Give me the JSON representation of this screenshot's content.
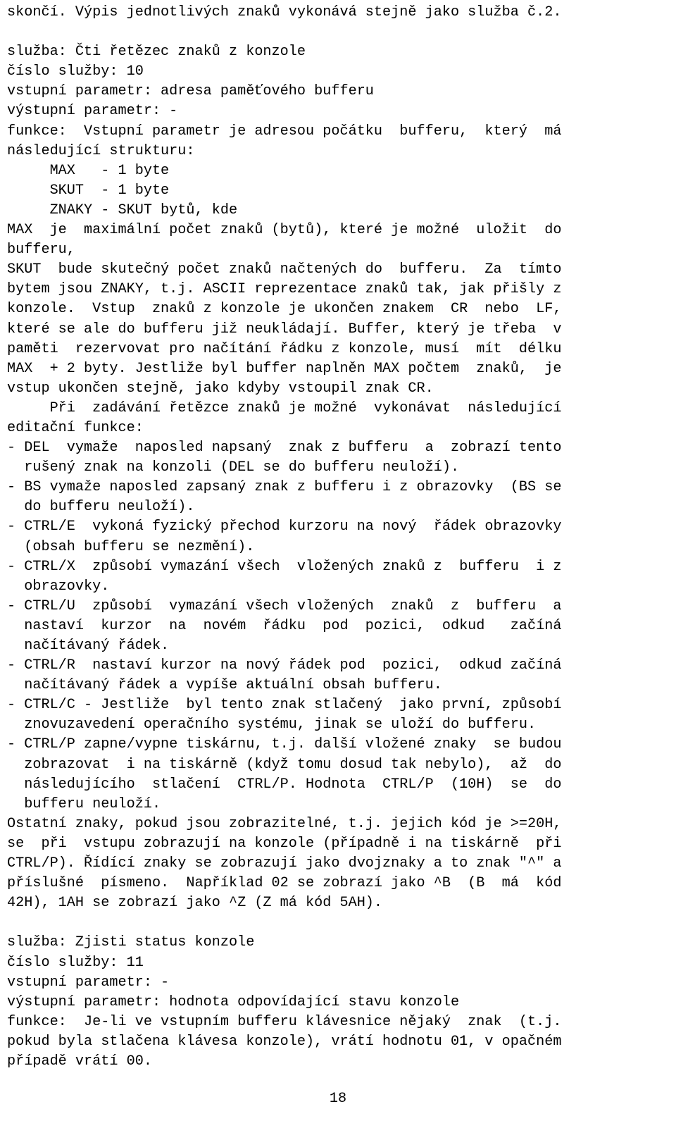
{
  "document": {
    "language": "cs",
    "page_number": "18",
    "body_lines": [
      "skončí. Výpis jednotlivých znaků vykonává stejně jako služba č.2.",
      "",
      "služba: Čti řetězec znaků z konzole",
      "číslo služby: 10",
      "vstupní parametr: adresa paměťového bufferu",
      "výstupní parametr: -",
      "funkce:  Vstupní parametr je adresou počátku  bufferu,  který  má",
      "následující strukturu:",
      "     MAX   - 1 byte",
      "     SKUT  - 1 byte",
      "     ZNAKY - SKUT bytů, kde",
      "MAX  je  maximální počet znaků (bytů), které je možné  uložit  do",
      "bufferu,",
      "SKUT  bude skutečný počet znaků načtených do  bufferu.  Za  tímto",
      "bytem jsou ZNAKY, t.j. ASCII reprezentace znaků tak, jak přišly z",
      "konzole.  Vstup  znaků z konzole je ukončen znakem  CR  nebo  LF,",
      "které se ale do bufferu již neukládají. Buffer, který je třeba  v",
      "paměti  rezervovat pro načítání řádku z konzole, musí  mít  délku",
      "MAX  + 2 byty. Jestliže byl buffer naplněn MAX počtem  znaků,  je",
      "vstup ukončen stejně, jako kdyby vstoupil znak CR.",
      "     Při  zadávání řetězce znaků je možné  vykonávat  následující",
      "editační funkce:",
      "- DEL  vymaže  naposled napsaný  znak z bufferu  a  zobrazí tento",
      "  rušený znak na konzoli (DEL se do bufferu neuloží).",
      "- BS vymaže naposled zapsaný znak z bufferu i z obrazovky  (BS se",
      "  do bufferu neuloží).",
      "- CTRL/E  vykoná fyzický přechod kurzoru na nový  řádek obrazovky",
      "  (obsah bufferu se nezmění).",
      "- CTRL/X  způsobí vymazání všech  vložených znaků z  bufferu  i z",
      "  obrazovky.",
      "- CTRL/U  způsobí  vymazání všech vložených  znaků  z  bufferu  a",
      "  nastaví  kurzor  na  novém  řádku  pod  pozici,  odkud   začíná",
      "  načítávaný řádek.",
      "- CTRL/R  nastaví kurzor na nový řádek pod  pozici,  odkud začíná",
      "  načítávaný řádek a vypíše aktuální obsah bufferu.",
      "- CTRL/C - Jestliže  byl tento znak stlačený  jako první, způsobí",
      "  znovuzavedení operačního systému, jinak se uloží do bufferu.",
      "- CTRL/P zapne/vypne tiskárnu, t.j. další vložené znaky  se budou",
      "  zobrazovat  i na tiskárně (když tomu dosud tak nebylo),  až  do",
      "  následujícího  stlačení  CTRL/P. Hodnota  CTRL/P  (10H)  se  do",
      "  bufferu neuloží.",
      "Ostatní znaky, pokud jsou zobrazitelné, t.j. jejich kód je >=20H,",
      "se  při  vstupu zobrazují na konzole (případně i na tiskárně  při",
      "CTRL/P). Řídící znaky se zobrazují jako dvojznaky a to znak \"^\" a",
      "příslušné  písmeno.  Například 02 se zobrazí jako ^B  (B  má  kód",
      "42H), 1AH se zobrazí jako ^Z (Z má kód 5AH).",
      "",
      "služba: Zjisti status konzole",
      "číslo služby: 11",
      "vstupní parametr: -",
      "výstupní parametr: hodnota odpovídající stavu konzole",
      "funkce:  Je-li ve vstupním bufferu klávesnice nějaký  znak  (t.j.",
      "pokud byla stlačena klávesa konzole), vrátí hodnotu 01, v opačném",
      "případě vrátí 00."
    ]
  }
}
